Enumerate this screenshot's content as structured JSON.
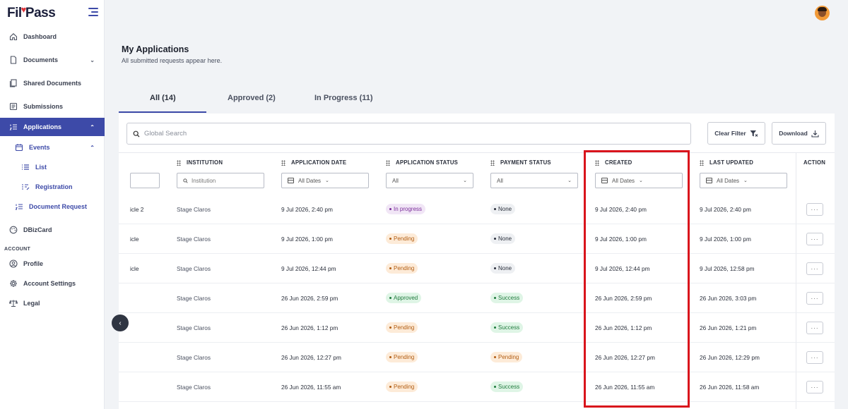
{
  "app": {
    "logo_text_a": "Fil",
    "logo_text_b": "Pass"
  },
  "sidebar": {
    "items": [
      {
        "label": "Dashboard",
        "icon": "home-icon"
      },
      {
        "label": "Documents",
        "icon": "document-icon"
      },
      {
        "label": "Shared Documents",
        "icon": "shared-documents-icon"
      },
      {
        "label": "Submissions",
        "icon": "submissions-icon"
      },
      {
        "label": "Applications",
        "icon": "applications-icon"
      },
      {
        "label": "Events",
        "icon": "calendar-icon"
      },
      {
        "label": "List",
        "icon": "list-icon"
      },
      {
        "label": "Registration",
        "icon": "registration-icon"
      },
      {
        "label": "Document Request",
        "icon": "document-request-icon"
      },
      {
        "label": "DBizCard",
        "icon": "palette-icon"
      },
      {
        "label": "Profile",
        "icon": "profile-icon"
      },
      {
        "label": "Account Settings",
        "icon": "gear-icon"
      },
      {
        "label": "Legal",
        "icon": "scale-icon"
      }
    ],
    "section_account": "ACCOUNT"
  },
  "page": {
    "title": "My Applications",
    "subtitle": "All submitted requests appear here."
  },
  "tabs": [
    {
      "label": "All (14)",
      "active": true
    },
    {
      "label": "Approved (2)",
      "active": false
    },
    {
      "label": "In Progress (11)",
      "active": false
    }
  ],
  "toolbar": {
    "search_placeholder": "Global Search",
    "clear_filter": "Clear Filter",
    "download": "Download"
  },
  "columns": {
    "institution": "INSTITUTION",
    "application_date": "APPLICATION DATE",
    "application_status": "APPLICATION STATUS",
    "payment_status": "PAYMENT STATUS",
    "created": "CREATED",
    "last_updated": "LAST UPDATED",
    "action": "ACTION"
  },
  "filters": {
    "institution_placeholder": "Institution",
    "all_dates": "All Dates",
    "all": "All"
  },
  "rows": [
    {
      "title": "icle 2",
      "institution": "Stage Claros",
      "application_date": "9 Jul 2026, 2:40 pm",
      "app_status": "In progress",
      "app_kind": "progress",
      "payment": "None",
      "pay_kind": "none",
      "created": "9 Jul 2026, 2:40 pm",
      "updated": "9 Jul 2026, 2:40 pm"
    },
    {
      "title": "icle",
      "institution": "Stage Claros",
      "application_date": "9 Jul 2026, 1:00 pm",
      "app_status": "Pending",
      "app_kind": "pending",
      "payment": "None",
      "pay_kind": "none",
      "created": "9 Jul 2026, 1:00 pm",
      "updated": "9 Jul 2026, 1:00 pm"
    },
    {
      "title": "icle",
      "institution": "Stage Claros",
      "application_date": "9 Jul 2026, 12:44 pm",
      "app_status": "Pending",
      "app_kind": "pending",
      "payment": "None",
      "pay_kind": "none",
      "created": "9 Jul 2026, 12:44 pm",
      "updated": "9 Jul 2026, 12:58 pm"
    },
    {
      "title": "",
      "institution": "Stage Claros",
      "application_date": "26 Jun 2026, 2:59 pm",
      "app_status": "Approved",
      "app_kind": "approved",
      "payment": "Success",
      "pay_kind": "success",
      "created": "26 Jun 2026, 2:59 pm",
      "updated": "26 Jun 2026, 3:03 pm"
    },
    {
      "title": "",
      "institution": "Stage Claros",
      "application_date": "26 Jun 2026, 1:12 pm",
      "app_status": "Pending",
      "app_kind": "pending",
      "payment": "Success",
      "pay_kind": "success",
      "created": "26 Jun 2026, 1:12 pm",
      "updated": "26 Jun 2026, 1:21 pm"
    },
    {
      "title": "",
      "institution": "Stage Claros",
      "application_date": "26 Jun 2026, 12:27 pm",
      "app_status": "Pending",
      "app_kind": "pending",
      "payment": "Pending",
      "pay_kind": "pending",
      "created": "26 Jun 2026, 12:27 pm",
      "updated": "26 Jun 2026, 12:29 pm"
    },
    {
      "title": "",
      "institution": "Stage Claros",
      "application_date": "26 Jun 2026, 11:55 am",
      "app_status": "Pending",
      "app_kind": "pending",
      "payment": "Success",
      "pay_kind": "success",
      "created": "26 Jun 2026, 11:55 am",
      "updated": "26 Jun 2026, 11:58 am"
    }
  ],
  "action_label": "···",
  "colors": {
    "accent": "#3d4aa8",
    "highlight": "#d9141c"
  }
}
